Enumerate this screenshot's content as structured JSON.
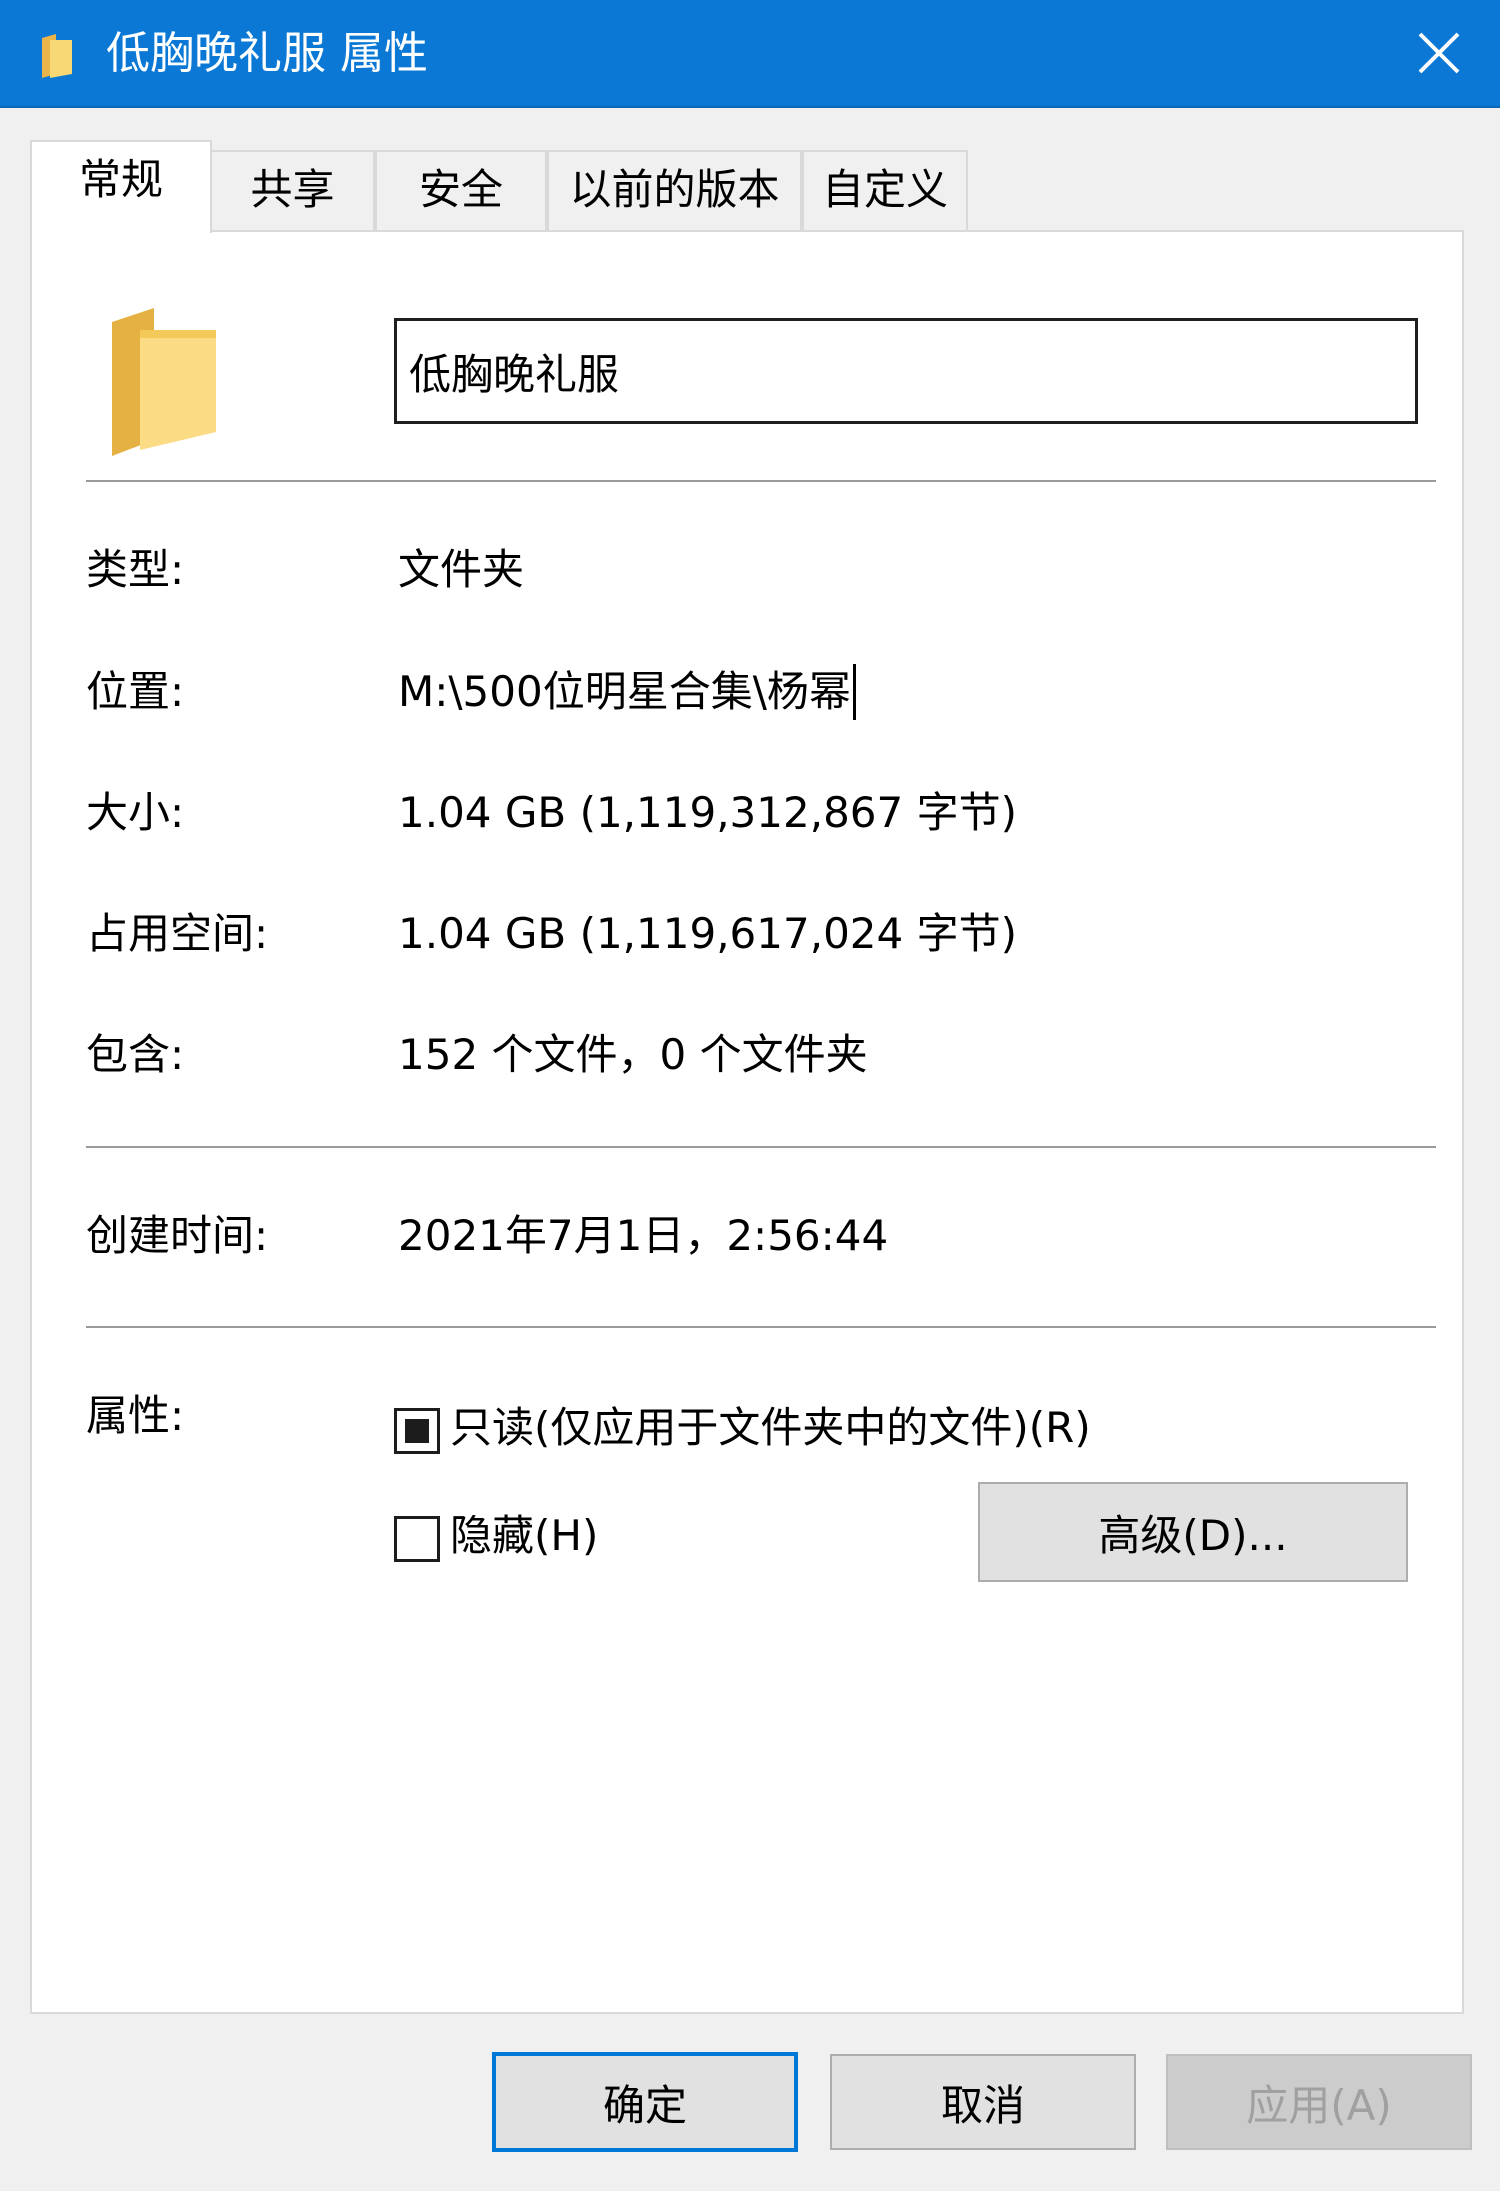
{
  "window": {
    "title": "低胸晚礼服 属性"
  },
  "tabs": [
    {
      "label": "常规",
      "active": true
    },
    {
      "label": "共享",
      "active": false
    },
    {
      "label": "安全",
      "active": false
    },
    {
      "label": "以前的版本",
      "active": false
    },
    {
      "label": "自定义",
      "active": false
    }
  ],
  "general": {
    "name_value": "低胸晚礼服",
    "type_label": "类型:",
    "type_value": "文件夹",
    "location_label": "位置:",
    "location_value": "M:\\500位明星合集\\杨幂",
    "size_label": "大小:",
    "size_value": "1.04 GB (1,119,312,867 字节)",
    "disk_size_label": "占用空间:",
    "disk_size_value": "1.04 GB (1,119,617,024 字节)",
    "contains_label": "包含:",
    "contains_value": "152 个文件，0 个文件夹",
    "created_label": "创建时间:",
    "created_value": "2021年7月1日，2:56:44",
    "attributes_label": "属性:",
    "readonly_label": "只读(仅应用于文件夹中的文件)(R)",
    "readonly_state": "indeterminate",
    "hidden_label": "隐藏(H)",
    "hidden_state": "unchecked",
    "advanced_button": "高级(D)..."
  },
  "footer": {
    "ok_button": "确定",
    "cancel_button": "取消",
    "apply_button": "应用(A)"
  },
  "colors": {
    "titlebar": "#0a78d4",
    "folder": "#f8d775",
    "default_button_border": "#0078d7"
  },
  "icons": {
    "title_icon": "folder-icon",
    "close_icon": "close-icon",
    "large_icon": "folder-icon"
  }
}
